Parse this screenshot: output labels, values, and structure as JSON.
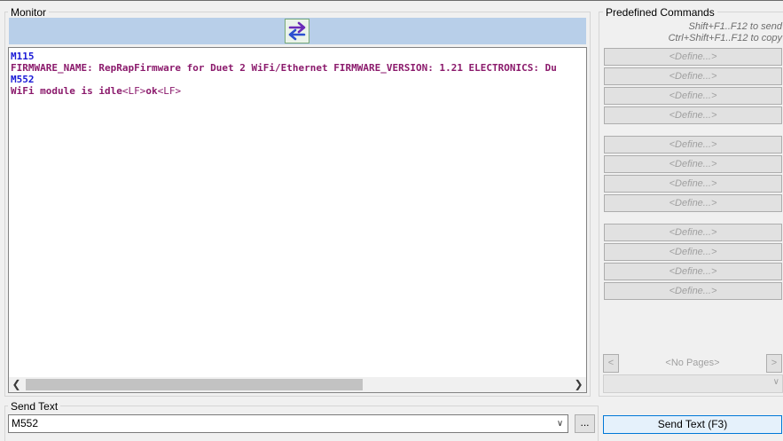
{
  "monitor": {
    "title": "Monitor",
    "lines": [
      {
        "type": "cmd",
        "text": "M115"
      },
      {
        "type": "resp",
        "text": "FIRMWARE_NAME: RepRapFirmware for Duet 2 WiFi/Ethernet FIRMWARE_VERSION: 1.21 ELECTRONICS: Du"
      },
      {
        "type": "cmd",
        "text": "M552"
      },
      {
        "type": "resp",
        "parts": [
          "WiFi module is idle",
          "<LF>",
          "ok",
          "<LF>"
        ]
      }
    ]
  },
  "predefined": {
    "title": "Predefined Commands",
    "hint_send": "Shift+F1..F12 to send",
    "hint_copy": "Ctrl+Shift+F1..F12 to copy",
    "button_label": "<Define...>",
    "button_count": 12,
    "pages_label": "<No Pages>",
    "prev_label": "<",
    "next_label": ">"
  },
  "send": {
    "title": "Send Text",
    "value": "M552",
    "more_label": "...",
    "send_button_label": "Send Text (F3)"
  },
  "icons": {
    "swap": "swap-arrows-icon",
    "scroll_left": "chevron-left-icon",
    "scroll_right": "chevron-right-icon",
    "dropdown": "chevron-down-icon"
  },
  "colors": {
    "monitor_bar": "#b8cfe9",
    "command_text": "#1a1ad6",
    "response_text": "#8b1a6c",
    "send_button_border": "#0078d7"
  }
}
